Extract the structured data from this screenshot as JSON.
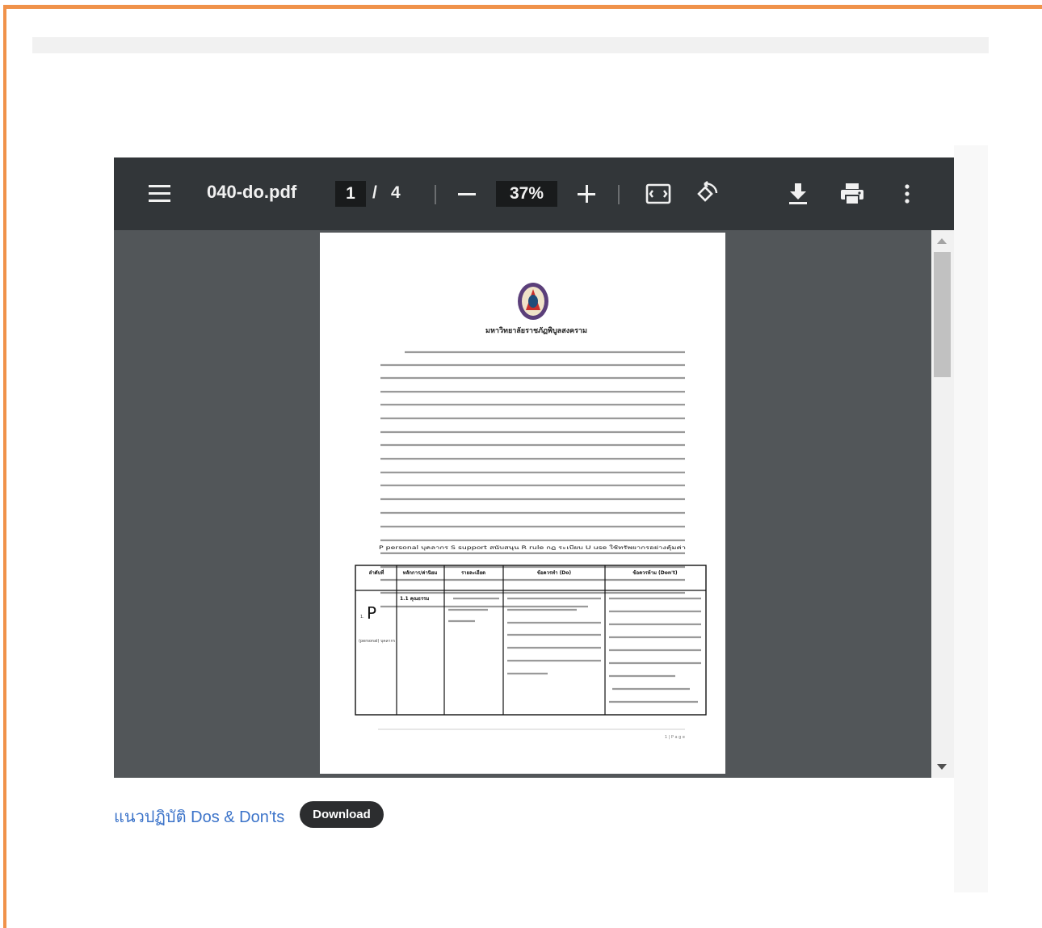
{
  "viewer": {
    "filename": "040-do.pdf",
    "current_page": "1",
    "page_separator": "/",
    "total_pages": "4",
    "zoom": "37%",
    "icons": {
      "menu": "menu-icon",
      "zoom_out": "minus-icon",
      "zoom_in": "plus-icon",
      "fit": "fit-to-page-icon",
      "rotate": "rotate-icon",
      "download": "download-icon",
      "print": "print-icon",
      "more": "more-vert-icon"
    }
  },
  "document": {
    "university": "มหาวิทยาลัยราชภัฏพิบูลสงคราม",
    "psru_line": "P personal บุคลากร S support สนับสนุน R rule กฎ ระเบียบ U use ใช้ทรัพยากรอย่างคุ้มค่า",
    "table_headers": [
      "ลำดับที่",
      "หลักการ/ค่านิยม",
      "รายละเอียด",
      "ข้อควรทำ (Do)",
      "ข้อควรห้าม (Don't)"
    ],
    "row1": {
      "letter": "P",
      "letter_prefix": "1.",
      "letter_sub": "(personal) บุคลากร",
      "principle": "1.1 คุณธรรม"
    },
    "footer": "1 | P a g e"
  },
  "caption": "แนวปฏิบัติ Dos & Don'ts",
  "download_button": "Download",
  "colors": {
    "accent_border": "#f0924a",
    "toolbar": "#323639",
    "viewer_bg": "#525659",
    "link": "#3b73c9",
    "button": "#2c2d2f"
  }
}
